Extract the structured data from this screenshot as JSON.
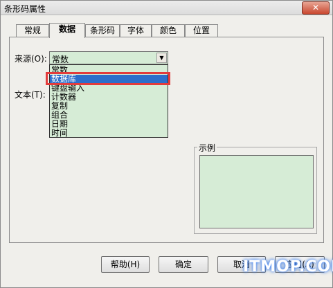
{
  "window": {
    "title": "条形码属性",
    "close_label": "✕"
  },
  "tabs": [
    {
      "label": "常规"
    },
    {
      "label": "数据"
    },
    {
      "label": "条形码"
    },
    {
      "label": "字体"
    },
    {
      "label": "颜色"
    },
    {
      "label": "位置"
    }
  ],
  "source": {
    "label": "来源(O):",
    "value": "常数"
  },
  "text": {
    "label": "文本(T):"
  },
  "dropdown": {
    "items": [
      "常数",
      "数据库",
      "键盘输入",
      "计数器",
      "复制",
      "组合",
      "日期",
      "时间"
    ],
    "selected_index": 1
  },
  "example": {
    "label": "示例"
  },
  "buttons": {
    "help": "帮助(H)",
    "ok": "确定",
    "cancel": "取消",
    "apply": "应用(A)"
  },
  "watermark": "ITMOP.COM",
  "colors": {
    "field_bg": "#d6ecd6",
    "selection": "#2c6ecb",
    "highlight_border": "#e33b3b"
  }
}
